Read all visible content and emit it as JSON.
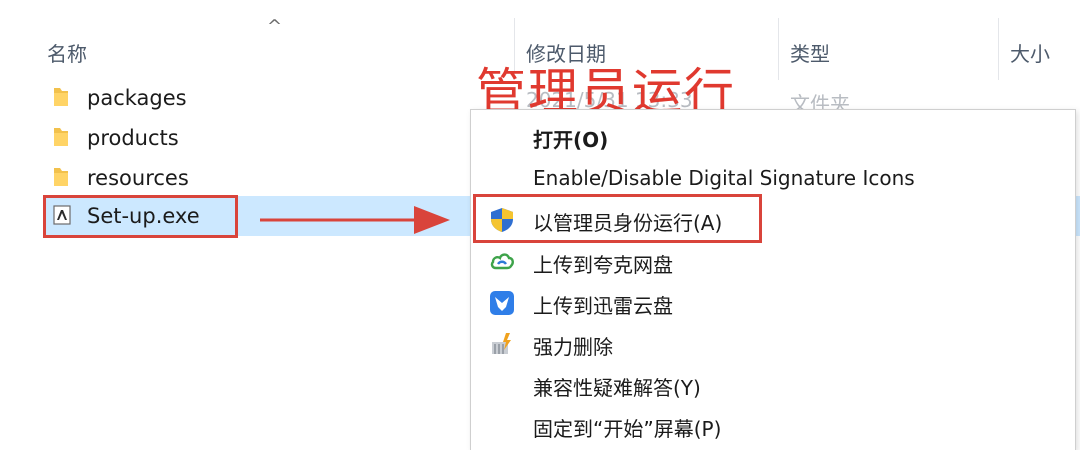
{
  "columns": {
    "name": "名称",
    "modified": "修改日期",
    "type": "类型",
    "size": "大小",
    "sort_caret": "^"
  },
  "files": [
    {
      "name": "packages",
      "icon": "folder-icon"
    },
    {
      "name": "products",
      "icon": "folder-icon"
    },
    {
      "name": "resources",
      "icon": "folder-icon"
    },
    {
      "name": "Set-up.exe",
      "icon": "exe-icon",
      "selected": true
    }
  ],
  "background_fragments": {
    "date": "2021/5/31 13:33",
    "type": "文件夹"
  },
  "annotation": {
    "title": "管理员运行",
    "color": "#e0392f"
  },
  "context_menu": {
    "items": [
      {
        "label": "打开(O)",
        "bold": true,
        "icon": ""
      },
      {
        "label": "Enable/Disable Digital Signature Icons",
        "icon": ""
      },
      {
        "label": "以管理员身份运行(A)",
        "icon": "uac-shield-icon",
        "highlighted": true
      },
      {
        "label": "上传到夸克网盘",
        "icon": "quark-cloud-icon"
      },
      {
        "label": "上传到迅雷云盘",
        "icon": "thunder-cloud-icon"
      },
      {
        "label": "强力删除",
        "icon": "shredder-icon"
      },
      {
        "label": "兼容性疑难解答(Y)",
        "icon": ""
      },
      {
        "label": "固定到“开始”屏幕(P)",
        "icon": ""
      }
    ]
  },
  "colors": {
    "selection": "#cce8ff",
    "annotation_red": "#d9443b"
  }
}
